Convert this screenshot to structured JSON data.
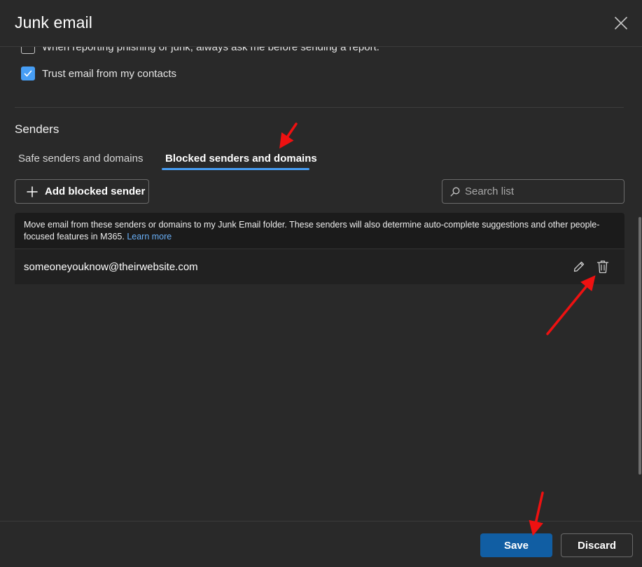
{
  "dialog": {
    "title": "Junk email"
  },
  "options": [
    {
      "label": "When reporting phishing or junk, always ask me before sending a report.",
      "checked": false
    },
    {
      "label": "Trust email from my contacts",
      "checked": true
    }
  ],
  "senders": {
    "section_title": "Senders",
    "tabs": [
      {
        "label": "Safe senders and domains",
        "active": false
      },
      {
        "label": "Blocked senders and domains",
        "active": true
      }
    ],
    "add_button_label": "Add blocked sender",
    "search_placeholder": "Search list",
    "info_text": "Move email from these senders or domains to my Junk Email folder. These senders will also determine auto-complete suggestions and other people-focused features in M365.",
    "learn_more": "Learn more",
    "list": [
      {
        "address": "someoneyouknow@theirwebsite.com"
      }
    ]
  },
  "footer": {
    "save_label": "Save",
    "discard_label": "Discard"
  },
  "colors": {
    "background": "#292929",
    "accent": "#479ef5",
    "primary_button": "#115ea3",
    "annotation_arrow": "#ff0000"
  },
  "icons": [
    "close-icon",
    "checkmark-icon",
    "plus-icon",
    "search-icon",
    "edit-icon",
    "delete-icon"
  ]
}
